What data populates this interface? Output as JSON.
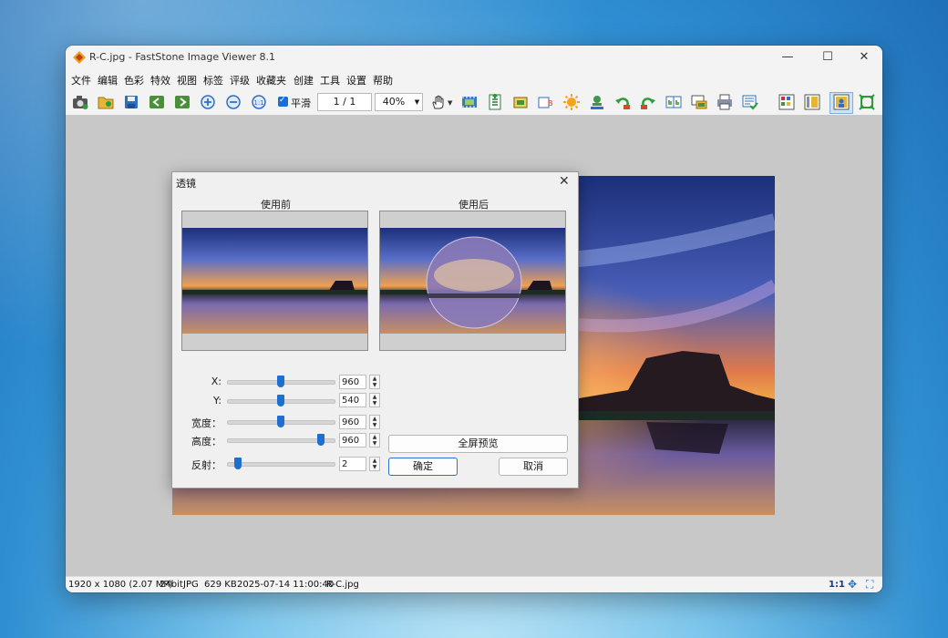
{
  "window": {
    "title": "R-C.jpg  -  FastStone Image Viewer 8.1",
    "minimize_glyph": "—",
    "maximize_glyph": "☐",
    "close_glyph": "✕"
  },
  "menu": [
    "文件",
    "编辑",
    "色彩",
    "特效",
    "视图",
    "标签",
    "评级",
    "收藏夹",
    "创建",
    "工具",
    "设置",
    "帮助"
  ],
  "toolbar": {
    "smooth_label": "平滑",
    "smooth_checked": true,
    "page_value": "1 / 1",
    "zoom_value": "40%",
    "icons": [
      "camera-icon",
      "open-folder-icon",
      "save-icon",
      "previous-icon",
      "next-icon",
      "zoom-in-icon",
      "zoom-out-icon",
      "actual-size-icon",
      "smooth-checkbox",
      "hand-tool-icon",
      "filmstrip-icon",
      "add-to-list-icon",
      "crop-icon",
      "resize-icon",
      "adjust-colors-icon",
      "stamp-icon",
      "rotate-left-icon",
      "rotate-right-icon",
      "compare-icon",
      "slideshow-icon",
      "print-icon",
      "email-icon",
      "layout-browser-icon",
      "layout-viewer-icon",
      "layout-fullscreen-icon",
      "fit-window-icon"
    ]
  },
  "status": {
    "dimensions": "1920 x 1080 (2.07 MP)",
    "bitdepth": "24bit",
    "format": "JPG",
    "filesize": "629 KB",
    "datetime": "2025-07-14 11:00:40",
    "filename": "R-C.jpg",
    "zoom_ratio": "1:1"
  },
  "dialog": {
    "title": "透镜",
    "close_glyph": "✕",
    "before_label": "使用前",
    "after_label": "使用后",
    "params": [
      {
        "label": "X:",
        "value": "960",
        "level": 0.5
      },
      {
        "label": "Y:",
        "value": "540",
        "level": 0.5
      },
      {
        "label": "宽度：",
        "value": "960",
        "level": 0.5
      },
      {
        "label": "高度：",
        "value": "960",
        "level": 0.88
      },
      {
        "label": "反射：",
        "value": "2",
        "level": 0.1
      }
    ],
    "fullscreen_preview": "全屏预览",
    "ok": "确定",
    "cancel": "取消"
  }
}
